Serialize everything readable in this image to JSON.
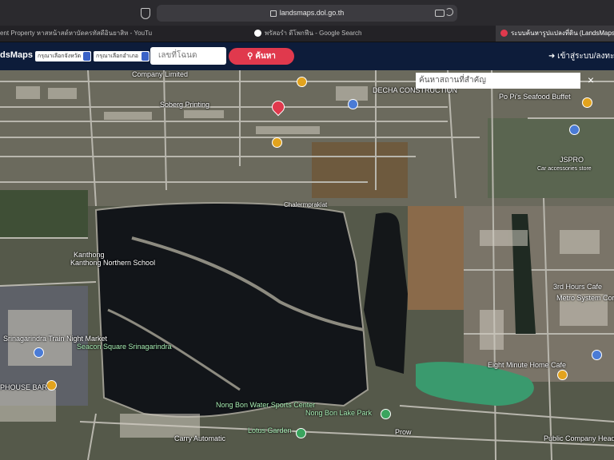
{
  "browser": {
    "url": "landsmaps.dol.go.th",
    "tabs": [
      {
        "label": "ent Property หาสหน้าสด์หาบัดครทัสดีอินยาสิห - YouTube"
      },
      {
        "label": "พรัสอรำ ดีโพกฟีน - Google Search"
      },
      {
        "label": "ระบบค้นหารูปแปลงที่ดิน (LandsMaps)"
      }
    ]
  },
  "app": {
    "brand": "dsMaps",
    "province_select": "กรุณาเลือกจังหวัด",
    "district_select": "กรุณาเลือกอำเภอ",
    "parcel_placeholder": "เลขที่โฉนด",
    "search_button": "ค้นหา",
    "login": "เข้าสู่ระบบ/ลงทะเบียน"
  },
  "map": {
    "search_placeholder": "ค้นหาสถานที่สำคัญ",
    "close": "×",
    "labels": [
      {
        "text": "Company Limited"
      },
      {
        "text": "Soberg Printing"
      },
      {
        "text": "DECHA CONSTRUCTION"
      },
      {
        "text": "Po Pi's Seafood Buffet"
      },
      {
        "text": "JSPRO"
      },
      {
        "text": "Car accessories store"
      },
      {
        "text": "Chalermprakiat"
      },
      {
        "text": "Kanthong Northern School"
      },
      {
        "text": "Srinagarindra Train Night Market"
      },
      {
        "text": "Seacon Square Srinagarindra"
      },
      {
        "text": "Nong Bon Water Sports Center"
      },
      {
        "text": "Nong Bon Lake Park"
      },
      {
        "text": "Lotus Garden"
      },
      {
        "text": "Prow"
      },
      {
        "text": "3rd Hours Cafe"
      },
      {
        "text": "Metro System Corporation"
      },
      {
        "text": "Eight Minute Home Cafe"
      },
      {
        "text": "Public Company Head Office"
      },
      {
        "text": "PHOUSE BAR"
      },
      {
        "text": "Carry Automatic"
      },
      {
        "text": "Kanthong"
      }
    ]
  }
}
